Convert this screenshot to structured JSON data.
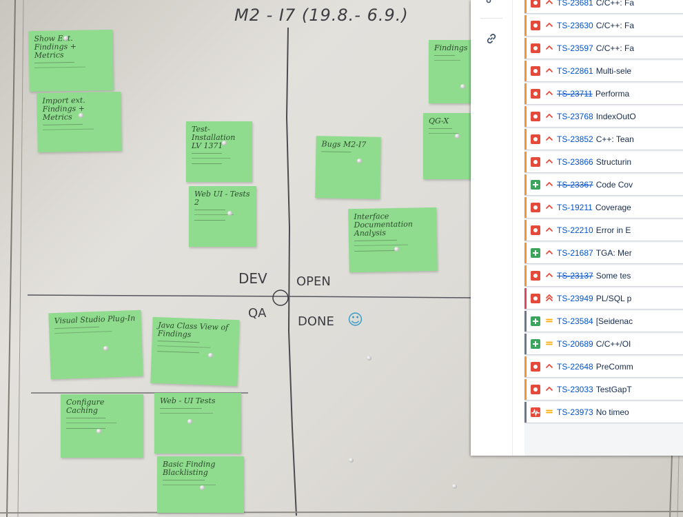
{
  "whiteboard": {
    "heading": "M2 - I7 (19.8.- 6.9.)",
    "zones": {
      "top_left": "DEV",
      "top_right": "OPEN",
      "bottom_left": "QA",
      "bottom_right": "DONE"
    },
    "smiley": "☺",
    "notes": [
      {
        "title": "Show Ext. Findings + Metrics"
      },
      {
        "title": "Import ext. Findings + Metrics"
      },
      {
        "title": "Test-Installation LV 1371"
      },
      {
        "title": "Web UI - Tests 2"
      },
      {
        "title": "Bugs M2-I7"
      },
      {
        "title": "Interface Documentation Analysis"
      },
      {
        "title": "Findings"
      },
      {
        "title": "QG-X"
      },
      {
        "title": "Visual Studio Plug-In"
      },
      {
        "title": "Java Class View of Findings"
      },
      {
        "title": "Configure Caching"
      },
      {
        "title": "Web - UI Tests"
      },
      {
        "title": "Basic Finding Blacklisting"
      }
    ]
  },
  "panel": {
    "sidebar_icons": [
      "share-icon",
      "link-icon"
    ],
    "issues": [
      {
        "type": "bug",
        "priority": "high",
        "key": "TS-23681",
        "summary": "C/C++: Fa",
        "done": false
      },
      {
        "type": "bug",
        "priority": "high",
        "key": "TS-23630",
        "summary": "C/C++: Fa",
        "done": false
      },
      {
        "type": "bug",
        "priority": "high",
        "key": "TS-23597",
        "summary": "C/C++: Fa",
        "done": false
      },
      {
        "type": "bug",
        "priority": "high",
        "key": "TS-22861",
        "summary": "Multi-sele",
        "done": false
      },
      {
        "type": "bug",
        "priority": "high",
        "key": "TS-23711",
        "summary": "Performa",
        "done": true
      },
      {
        "type": "bug",
        "priority": "high",
        "key": "TS-23768",
        "summary": "IndexOutO",
        "done": false
      },
      {
        "type": "bug",
        "priority": "high",
        "key": "TS-23852",
        "summary": "C++: Tean",
        "done": false
      },
      {
        "type": "bug",
        "priority": "high",
        "key": "TS-23866",
        "summary": "Structurin",
        "done": false
      },
      {
        "type": "improvement",
        "priority": "high",
        "key": "TS-23367",
        "summary": "Code Cov",
        "done": true
      },
      {
        "type": "bug",
        "priority": "high",
        "key": "TS-19211",
        "summary": "Coverage",
        "done": false
      },
      {
        "type": "bug",
        "priority": "high",
        "key": "TS-22210",
        "summary": "Error in E",
        "done": false
      },
      {
        "type": "improvement",
        "priority": "high",
        "key": "TS-21687",
        "summary": "TGA: Mer",
        "done": false
      },
      {
        "type": "bug",
        "priority": "high",
        "key": "TS-23137",
        "summary": "Some tes",
        "done": true
      },
      {
        "type": "bug",
        "priority": "highest",
        "key": "TS-23949",
        "summary": "PL/SQL p",
        "done": false
      },
      {
        "type": "improvement",
        "priority": "medium",
        "key": "TS-23584",
        "summary": "[Seidenac",
        "done": false
      },
      {
        "type": "improvement",
        "priority": "medium",
        "key": "TS-20689",
        "summary": "C/C++/OI",
        "done": false
      },
      {
        "type": "bug",
        "priority": "high",
        "key": "TS-22648",
        "summary": "PreComm",
        "done": false
      },
      {
        "type": "bug",
        "priority": "high",
        "key": "TS-23033",
        "summary": "TestGapT",
        "done": false
      },
      {
        "type": "pulse",
        "priority": "medium",
        "key": "TS-23973",
        "summary": "No timeo",
        "done": false
      }
    ],
    "priority_glyphs": {
      "high": "^",
      "highest": "»",
      "medium": "="
    },
    "colors": {
      "bug": "#e5493a",
      "improvement": "#3ba55d",
      "link": "#0052cc",
      "sticky": "#8fdc8e"
    }
  }
}
